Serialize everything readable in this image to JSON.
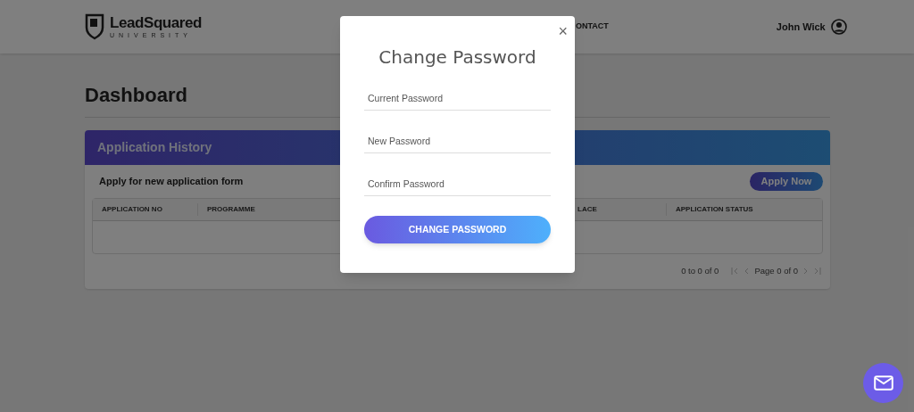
{
  "header": {
    "logo": {
      "name": "LeadSquared",
      "tagline": "UNIVERSITY"
    },
    "nav_item": "ONTACT",
    "user": "John Wick"
  },
  "page_title": "Dashboard",
  "card": {
    "title": "Application History",
    "subtitle": "Apply for new application form",
    "apply_button": "Apply Now",
    "columns": [
      "APPLICATION NO",
      "PROGRAMME",
      "LACE",
      "APPLICATION STATUS"
    ],
    "pagination": {
      "summary": "0 to 0 of 0",
      "page": "Page 0 of 0"
    }
  },
  "modal": {
    "title": "Change Password",
    "close": "×",
    "fields": [
      {
        "placeholder": "Current Password"
      },
      {
        "placeholder": "New Password"
      },
      {
        "placeholder": "Confirm Password"
      }
    ],
    "button": "CHANGE PASSWORD"
  }
}
